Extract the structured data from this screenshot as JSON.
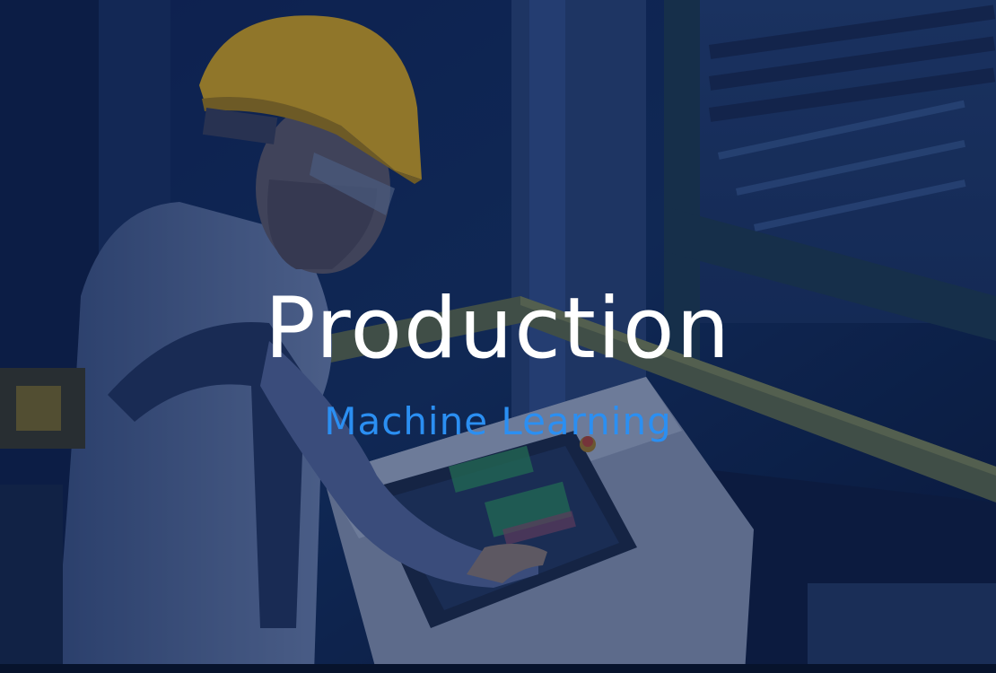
{
  "hero": {
    "title": "Production",
    "subtitle": "Machine Learning"
  },
  "colors": {
    "overlay": "#0d1d42",
    "title": "#ffffff",
    "subtitle": "#2b8ff2",
    "helmet": "#d9a81e"
  }
}
